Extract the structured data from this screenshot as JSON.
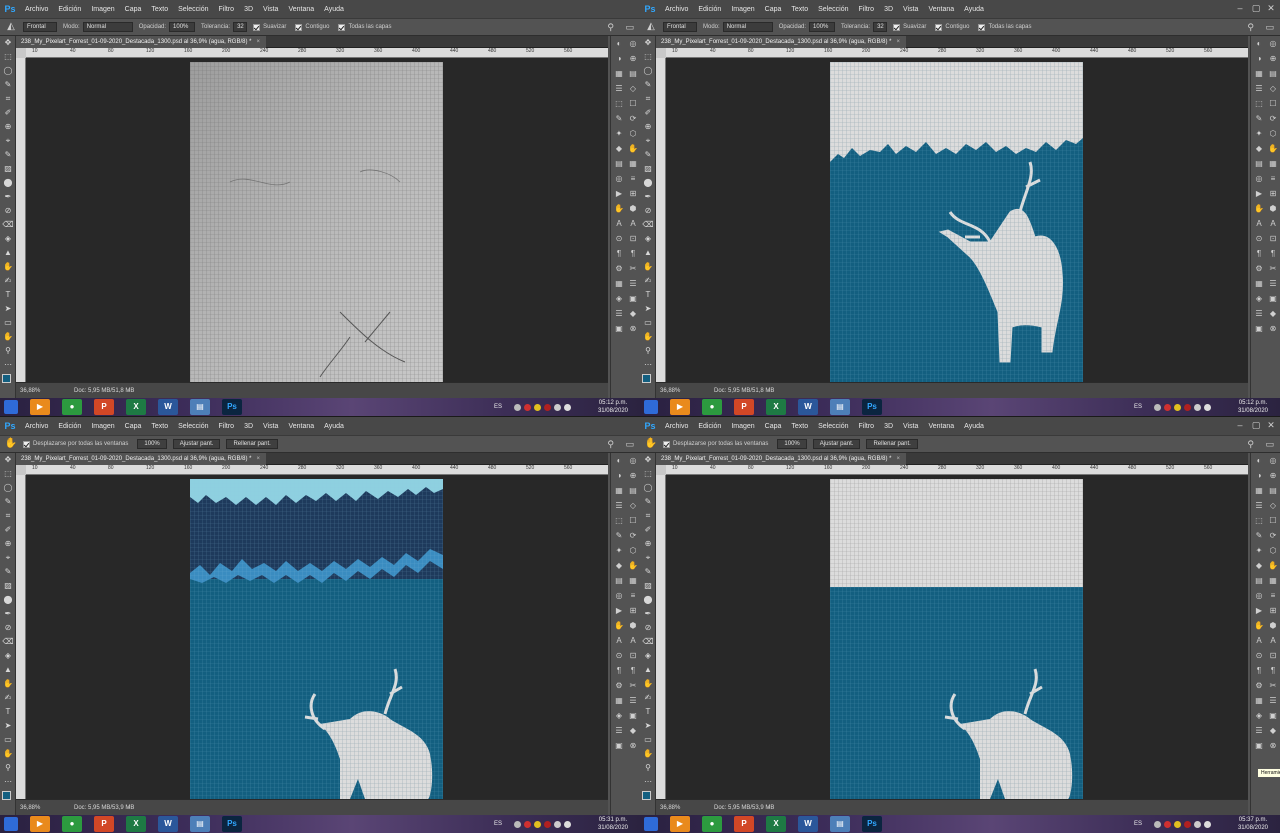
{
  "menu": [
    "Archivo",
    "Edición",
    "Imagen",
    "Capa",
    "Texto",
    "Selección",
    "Filtro",
    "3D",
    "Vista",
    "Ventana",
    "Ayuda"
  ],
  "window_controls": {
    "minimize": "–",
    "maximize": "▢",
    "close": "✕"
  },
  "bucket_options": {
    "source": "Frontal",
    "mode_label": "Modo:",
    "mode": "Normal",
    "opacity_label": "Opacidad:",
    "opacity": "100%",
    "tolerance_label": "Tolerancia:",
    "tolerance": "32",
    "checks": [
      "Suavizar",
      "Contiguo",
      "Todas las capas"
    ]
  },
  "hand_options": {
    "scroll_all_label": "Desplazarse por todas las ventanas",
    "buttons": [
      "100%",
      "Ajustar pant.",
      "Rellenar pant."
    ]
  },
  "document": {
    "tab_title": "238_My_Pixelart_Forrest_01-09-2020_Destacada_1300.psd al 36,9% (agua, RGB/8) *",
    "close_glyph": "×",
    "zoom": "36,88%",
    "doc_size_a": "Doc: 5,95 MB/51,8 MB",
    "doc_size_b": "Doc: 5,95 MB/53,9 MB",
    "status_arrow": "›"
  },
  "ruler_ticks": [
    "10",
    "40",
    "80",
    "120",
    "160",
    "200",
    "240",
    "280",
    "320",
    "360",
    "400",
    "440",
    "480",
    "520",
    "560"
  ],
  "tooltip": "Herramienta Mano (H)",
  "taskbar": {
    "apps": [
      {
        "name": "media-player",
        "glyph": "▶",
        "color": "#e98a1c"
      },
      {
        "name": "chrome",
        "glyph": "●",
        "color": "#2c9a3f"
      },
      {
        "name": "powerpoint",
        "glyph": "P",
        "color": "#d24726"
      },
      {
        "name": "excel",
        "glyph": "X",
        "color": "#1e7a44"
      },
      {
        "name": "word",
        "glyph": "W",
        "color": "#2b579a"
      },
      {
        "name": "notes",
        "glyph": "▤",
        "color": "#4d7fb8"
      },
      {
        "name": "photoshop",
        "glyph": "Ps",
        "color": "#0b2540"
      }
    ],
    "lang": "ES",
    "date": "31/08/2020",
    "times": [
      "05:12 p.m.",
      "05:12 p.m.",
      "05:31 p.m.",
      "05:37 p.m."
    ]
  },
  "colors": {
    "ps_blue": "#31a8ff",
    "water": "#135f80",
    "water_dark": "#1e3a5c",
    "snow": "#d8d8d8",
    "sky_light": "#8ed0e0"
  }
}
